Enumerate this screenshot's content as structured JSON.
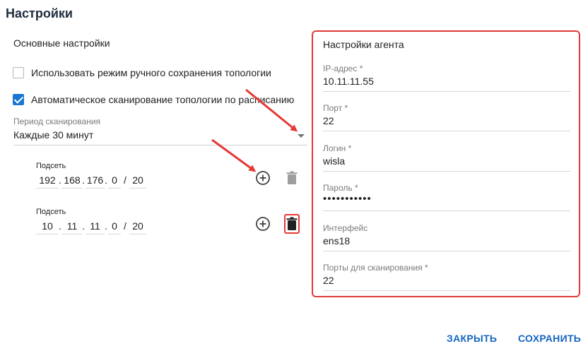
{
  "dialog": {
    "title": "Настройки"
  },
  "general": {
    "section_title": "Основные настройки",
    "manual_save": {
      "label": "Использовать режим ручного сохранения топологии",
      "checked": false
    },
    "auto_scan": {
      "label": "Автоматическое сканирование топологии по расписанию",
      "checked": true
    },
    "scan_period": {
      "label": "Период сканирования",
      "value": "Каждые 30 минут"
    }
  },
  "subnets": [
    {
      "label": "Подсеть",
      "octets": [
        "192",
        "168",
        "176",
        "0"
      ],
      "mask": "20"
    },
    {
      "label": "Подсеть",
      "octets": [
        "10",
        "11",
        "11",
        "0"
      ],
      "mask": "20"
    }
  ],
  "agent": {
    "title": "Настройки агента",
    "fields": [
      {
        "label": "IP-адрес *",
        "value": "10.11.11.55"
      },
      {
        "label": "Порт *",
        "value": "22"
      },
      {
        "label": "Логин *",
        "value": "wisla"
      },
      {
        "label": "Пароль *",
        "value": "•••••••••••"
      },
      {
        "label": "Интерфейс",
        "value": "ens18"
      },
      {
        "label": "Порты для сканирования *",
        "value": "22"
      }
    ]
  },
  "footer": {
    "close_label": "ЗАКРЫТЬ",
    "save_label": "СОХРАНИТЬ"
  },
  "colors": {
    "accent": "#1976d2",
    "highlight": "#e03a3a",
    "footer_text": "#1565c0"
  },
  "icons": {
    "add": "add-circle-icon",
    "delete": "trash-icon",
    "dropdown": "caret-down-icon"
  }
}
